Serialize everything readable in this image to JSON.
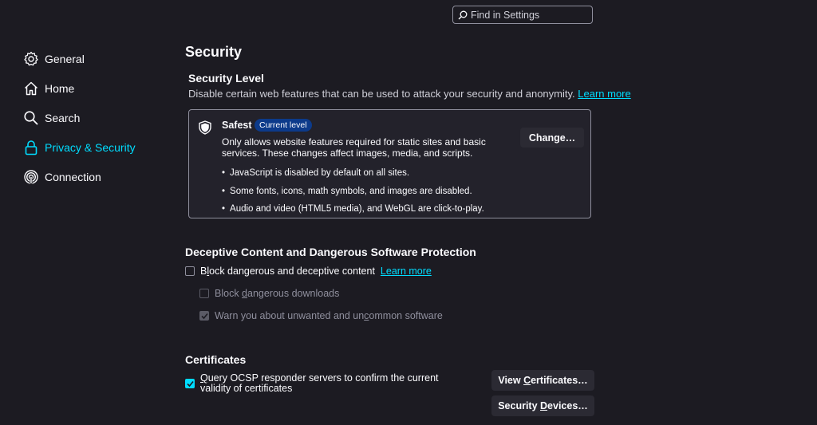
{
  "search": {
    "placeholder": "Find in Settings"
  },
  "nav": [
    {
      "label": "General",
      "icon": "gear-icon"
    },
    {
      "label": "Home",
      "icon": "home-icon"
    },
    {
      "label": "Search",
      "icon": "search-icon"
    },
    {
      "label": "Privacy & Security",
      "icon": "lock-icon",
      "active": true
    },
    {
      "label": "Connection",
      "icon": "connection-icon"
    }
  ],
  "main": {
    "title": "Security",
    "security_level": {
      "title": "Security Level",
      "description": "Disable certain web features that can be used to attack your security and anonymity.",
      "learn_more": "Learn more",
      "card": {
        "name": "Safest",
        "badge": "Current level",
        "description": "Only allows website features required for static sites and basic services. These changes affect images, media, and scripts.",
        "bullets": [
          "JavaScript is disabled by default on all sites.",
          "Some fonts, icons, math symbols, and images are disabled.",
          "Audio and video (HTML5 media), and WebGL are click-to-play."
        ],
        "change_button": "Change…"
      }
    },
    "deceptive": {
      "title": "Deceptive Content and Dangerous Software Protection",
      "block_dangerous_pre": "B",
      "block_dangerous_acc": "l",
      "block_dangerous_post": "ock dangerous and deceptive content",
      "learn_more": "Learn more",
      "downloads_pre": "Block ",
      "downloads_acc": "d",
      "downloads_post": "angerous downloads",
      "unwanted_pre": "Warn you about unwanted and un",
      "unwanted_acc": "c",
      "unwanted_post": "ommon software"
    },
    "certificates": {
      "title": "Certificates",
      "ocsp_acc": "Q",
      "ocsp_post": "uery OCSP responder servers to confirm the current validity of certificates",
      "view_pre": "View ",
      "view_acc": "C",
      "view_post": "ertificates…",
      "devices_pre": "Security ",
      "devices_acc": "D",
      "devices_post": "evices…"
    }
  },
  "colors": {
    "accent": "#00ddff",
    "background": "#1c1b22",
    "badge": "#0c3a8a"
  }
}
